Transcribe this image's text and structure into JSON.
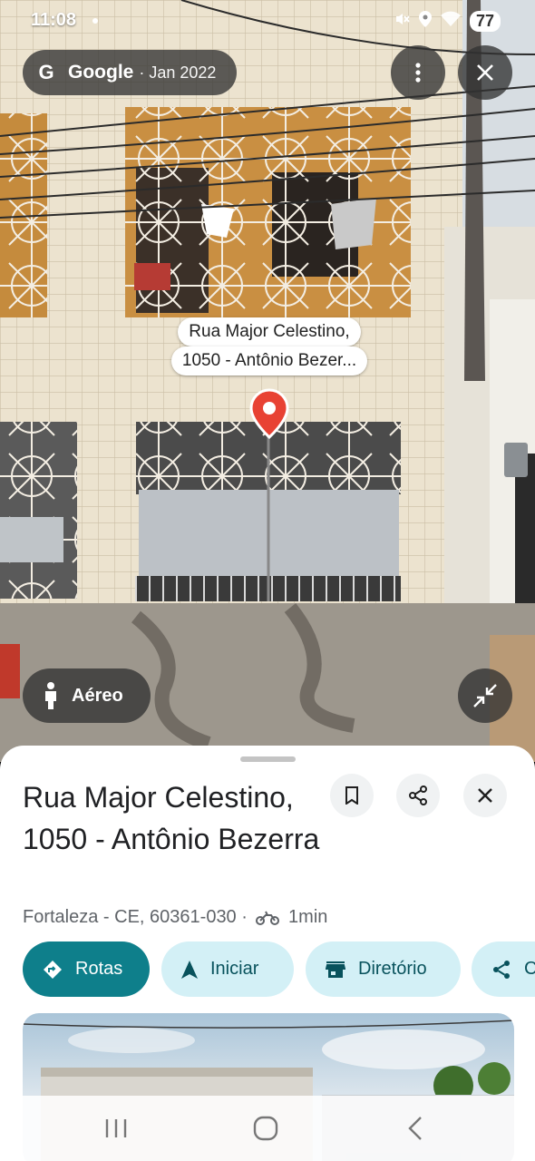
{
  "status_bar": {
    "time": "11:08",
    "battery": "77",
    "icons": [
      "mute-icon",
      "location-icon",
      "wifi-icon",
      "battery-icon"
    ]
  },
  "street_view": {
    "provider": "Google",
    "date": "· Jan 2022",
    "address_label_line1": "Rua Major Celestino,",
    "address_label_line2": "1050 - Antônio Bezer...",
    "aereo_label": "Aéreo",
    "accent_pin_color": "#e84234"
  },
  "place": {
    "title": "Rua Major Celestino, 1050 - Antônio Bezerra",
    "subtitle_address": "Fortaleza - CE, 60361-030 ·",
    "travel_time": "1min"
  },
  "actions": [
    {
      "label": "Rotas",
      "icon": "directions-icon",
      "primary": true
    },
    {
      "label": "Iniciar",
      "icon": "navigation-arrow-icon",
      "primary": false
    },
    {
      "label": "Diretório",
      "icon": "store-icon",
      "primary": false
    },
    {
      "label": "C",
      "icon": "share-icon",
      "primary": false
    }
  ],
  "colors": {
    "primary_action": "#0e7f8b",
    "secondary_action": "#d3f0f6"
  }
}
